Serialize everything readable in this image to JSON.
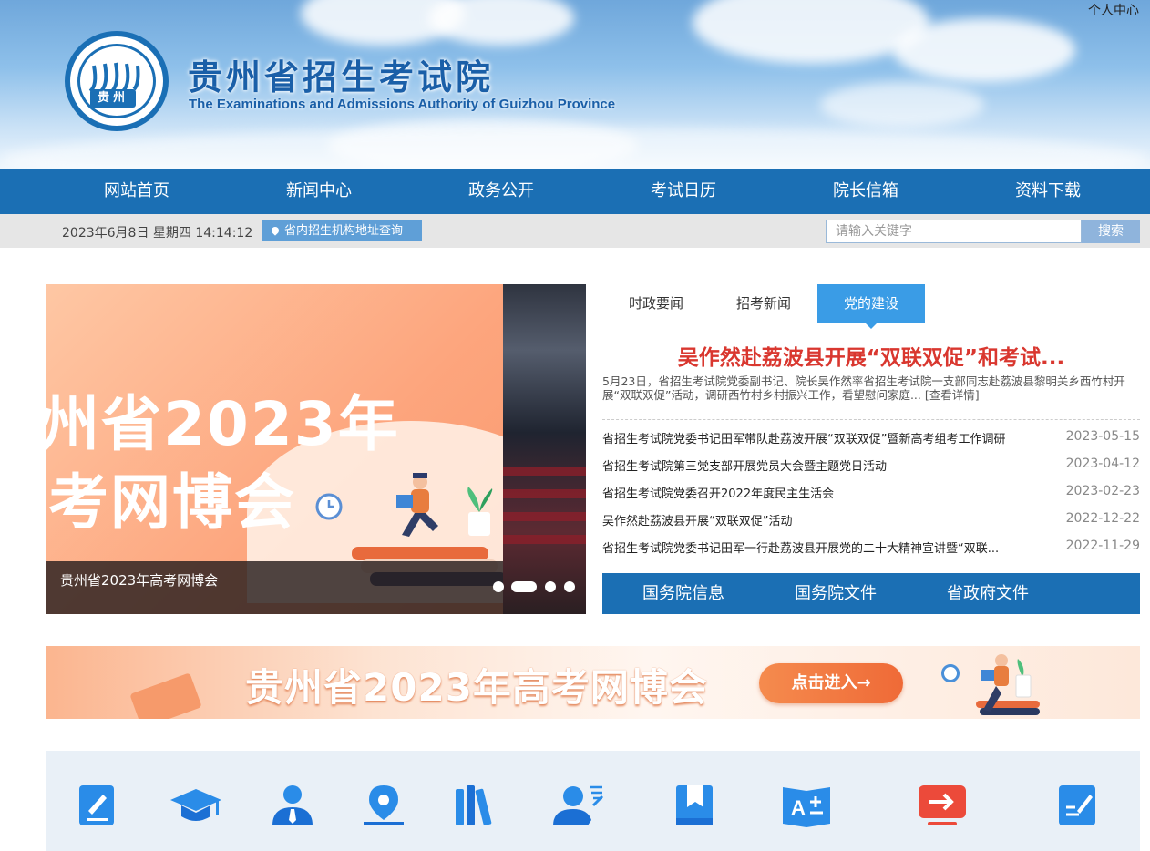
{
  "header": {
    "personal_center": "个人中心",
    "title_cn": "贵州省招生考试院",
    "title_en": "The Examinations and Admissions Authority of Guizhou Province",
    "logo_label": "贵州",
    "brand_color": "#1b6fb4"
  },
  "nav": {
    "items": [
      "网站首页",
      "新闻中心",
      "政务公开",
      "考试日历",
      "院长信箱",
      "资料下载"
    ]
  },
  "infobar": {
    "datetime": "2023年6月8日 星期四 14:14:12",
    "address_link": "省内招生机构地址查询",
    "search_placeholder": "请输入关键字",
    "search_button": "搜索"
  },
  "slider": {
    "slide_text_line1": "州省2023年",
    "slide_text_line2": "考网博会",
    "caption": "贵州省2023年高考网博会",
    "dot_count": 4,
    "active_dot": 2
  },
  "news": {
    "tabs": [
      "时政要闻",
      "招考新闻",
      "党的建设"
    ],
    "active_tab": 2,
    "headline": "吴作然赴荔波县开展“双联双促”和考试...",
    "summary": "5月23日，省招生考试院党委副书记、院长吴作然率省招生考试院一支部同志赴荔波县黎明关乡西竹村开展“双联双促”活动，调研西竹村乡村振兴工作，看望慰问家庭...",
    "more": "[查看详情]",
    "items": [
      {
        "title": "省招生考试院党委书记田军带队赴荔波开展“双联双促”暨新高考组考工作调研",
        "date": "2023-05-15"
      },
      {
        "title": "省招生考试院第三党支部开展党员大会暨主题党日活动",
        "date": "2023-04-12"
      },
      {
        "title": "省招生考试院党委召开2022年度民主生活会",
        "date": "2023-02-23"
      },
      {
        "title": "吴作然赴荔波县开展“双联双促”活动",
        "date": "2022-12-22"
      },
      {
        "title": "省招生考试院党委书记田军一行赴荔波县开展党的二十大精神宣讲暨“双联...",
        "date": "2022-11-29"
      }
    ],
    "gov_links": [
      "国务院信息",
      "国务院文件",
      "省政府文件"
    ],
    "headline_color": "#d9372f",
    "tab_active_color": "#3a9ce6"
  },
  "banner": {
    "text": "贵州省2023年高考网博会",
    "button": "点击进入→"
  },
  "quick_icons": [
    "edit-icon",
    "graduation-cap-icon",
    "user-icon",
    "location-pin-icon",
    "books-icon",
    "user-edit-icon",
    "bookmark-icon",
    "font-book-icon",
    "arrow-right-icon",
    "document-edit-icon"
  ]
}
